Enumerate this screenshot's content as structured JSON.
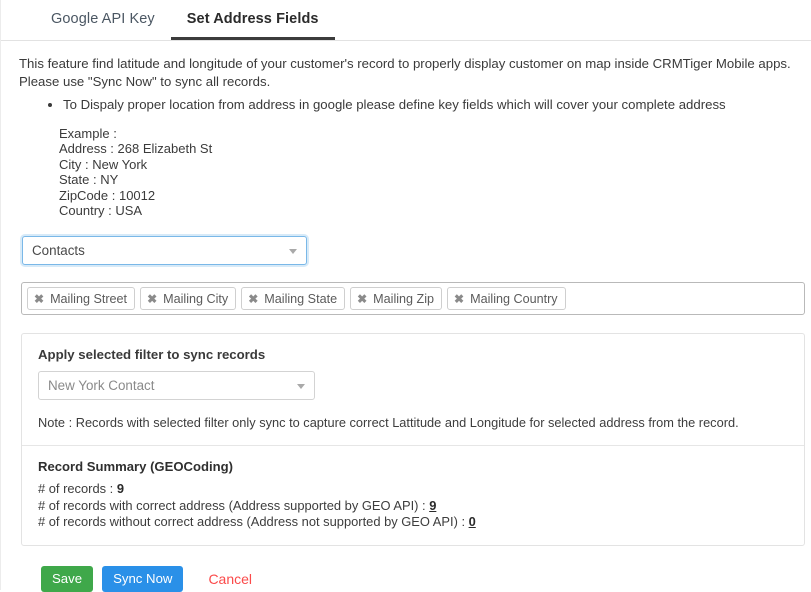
{
  "tabs": [
    {
      "label": "Google API Key",
      "active": false
    },
    {
      "label": "Set Address Fields",
      "active": true
    }
  ],
  "intro": {
    "line1": "This feature find latitude and longitude of your customer's record to properly display customer on map inside CRMTiger Mobile apps.",
    "line2": "Please use \"Sync Now\" to sync all records.",
    "bullet1": "To Dispaly proper location from address in google please define key fields which will cover your complete address"
  },
  "example": {
    "title": "Example :",
    "address": "Address : 268 Elizabeth St",
    "city": "City : New York",
    "state": "State : NY",
    "zipcode": "ZipCode : 10012",
    "country": "Country : USA"
  },
  "module_select": {
    "value": "Contacts",
    "caret_icon": "chevron-down-icon"
  },
  "address_fields": {
    "remove_icon": "close-icon",
    "chips": [
      {
        "label": "Mailing Street"
      },
      {
        "label": "Mailing City"
      },
      {
        "label": "Mailing State"
      },
      {
        "label": "Mailing Zip"
      },
      {
        "label": "Mailing Country"
      }
    ]
  },
  "filter": {
    "label": "Apply selected filter to sync records",
    "value": "New York Contact",
    "caret_icon": "chevron-down-icon",
    "note": "Note : Records with selected filter only sync to capture correct Lattitude and Longitude for selected address from the record."
  },
  "summary": {
    "title": "Record Summary (GEOCoding)",
    "rows": [
      {
        "label": "# of records : ",
        "value": "9",
        "link": false
      },
      {
        "label": "# of records with correct address (Address supported by GEO API) : ",
        "value": "9",
        "link": true
      },
      {
        "label": "# of records without correct address (Address not supported by GEO API) : ",
        "value": "0",
        "link": true
      }
    ]
  },
  "footer": {
    "save_label": "Save",
    "sync_label": "Sync Now",
    "cancel_label": "Cancel"
  },
  "colors": {
    "save_green": "#3fa84a",
    "sync_blue": "#2a90e8",
    "cancel_red": "#fb4a4a",
    "active_tab_underline": "#3c3c3c",
    "focus_blue": "#7ab8e8"
  }
}
